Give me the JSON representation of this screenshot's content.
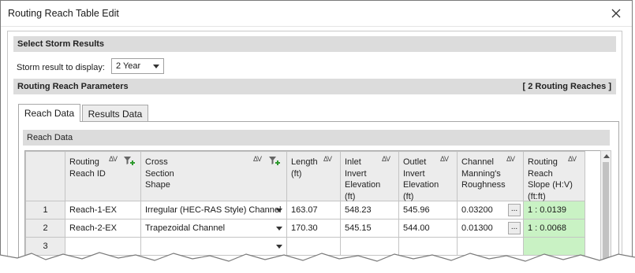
{
  "window": {
    "title": "Routing Reach Table Edit",
    "close_icon": "close-icon"
  },
  "storm": {
    "section_title": "Select Storm Results",
    "label": "Storm result to display:",
    "selected": "2 Year"
  },
  "params": {
    "section_title": "Routing Reach Parameters",
    "count_label": "[ 2 Routing Reaches ]"
  },
  "tabs": [
    {
      "label": "Reach Data",
      "active": true
    },
    {
      "label": "Results Data",
      "active": false
    }
  ],
  "reach_data": {
    "section_title": "Reach Data",
    "columns": {
      "c1": {
        "l1": "Routing",
        "l2": "Reach ID",
        "l3": "",
        "l4": ""
      },
      "c2": {
        "l1": "Cross",
        "l2": "Section",
        "l3": "Shape",
        "l4": ""
      },
      "c3": {
        "l1": "Length",
        "l2": "(ft)",
        "l3": "",
        "l4": ""
      },
      "c4": {
        "l1": "Inlet",
        "l2": "Invert",
        "l3": "Elevation",
        "l4": "(ft)"
      },
      "c5": {
        "l1": "Outlet",
        "l2": "Invert",
        "l3": "Elevation",
        "l4": "(ft)"
      },
      "c6": {
        "l1": "Channel",
        "l2": "Manning's",
        "l3": "Roughness",
        "l4": ""
      },
      "c7": {
        "l1": "Routing",
        "l2": "Reach",
        "l3": "Slope (H:V)",
        "l4": "(ft:ft)"
      }
    },
    "sort_glyph": "ΔV",
    "dots_label": "...",
    "rows": [
      {
        "num": "1",
        "reach_id": "Reach-1-EX",
        "shape": "Irregular (HEC-RAS Style) Channel",
        "length": "163.07",
        "inlet": "548.23",
        "outlet": "545.96",
        "roughness": "0.03200",
        "slope": "1 : 0.0139"
      },
      {
        "num": "2",
        "reach_id": "Reach-2-EX",
        "shape": "Trapezoidal Channel",
        "length": "170.30",
        "inlet": "545.15",
        "outlet": "544.00",
        "roughness": "0.01300",
        "slope": "1 : 0.0068"
      },
      {
        "num": "3",
        "reach_id": "",
        "shape": "",
        "length": "",
        "inlet": "",
        "outlet": "",
        "roughness": "",
        "slope": ""
      }
    ]
  },
  "colors": {
    "computed_cell": "#c9f2c4",
    "section_bg": "#dcdcdc",
    "filter_plus": "#2e9a2e"
  }
}
